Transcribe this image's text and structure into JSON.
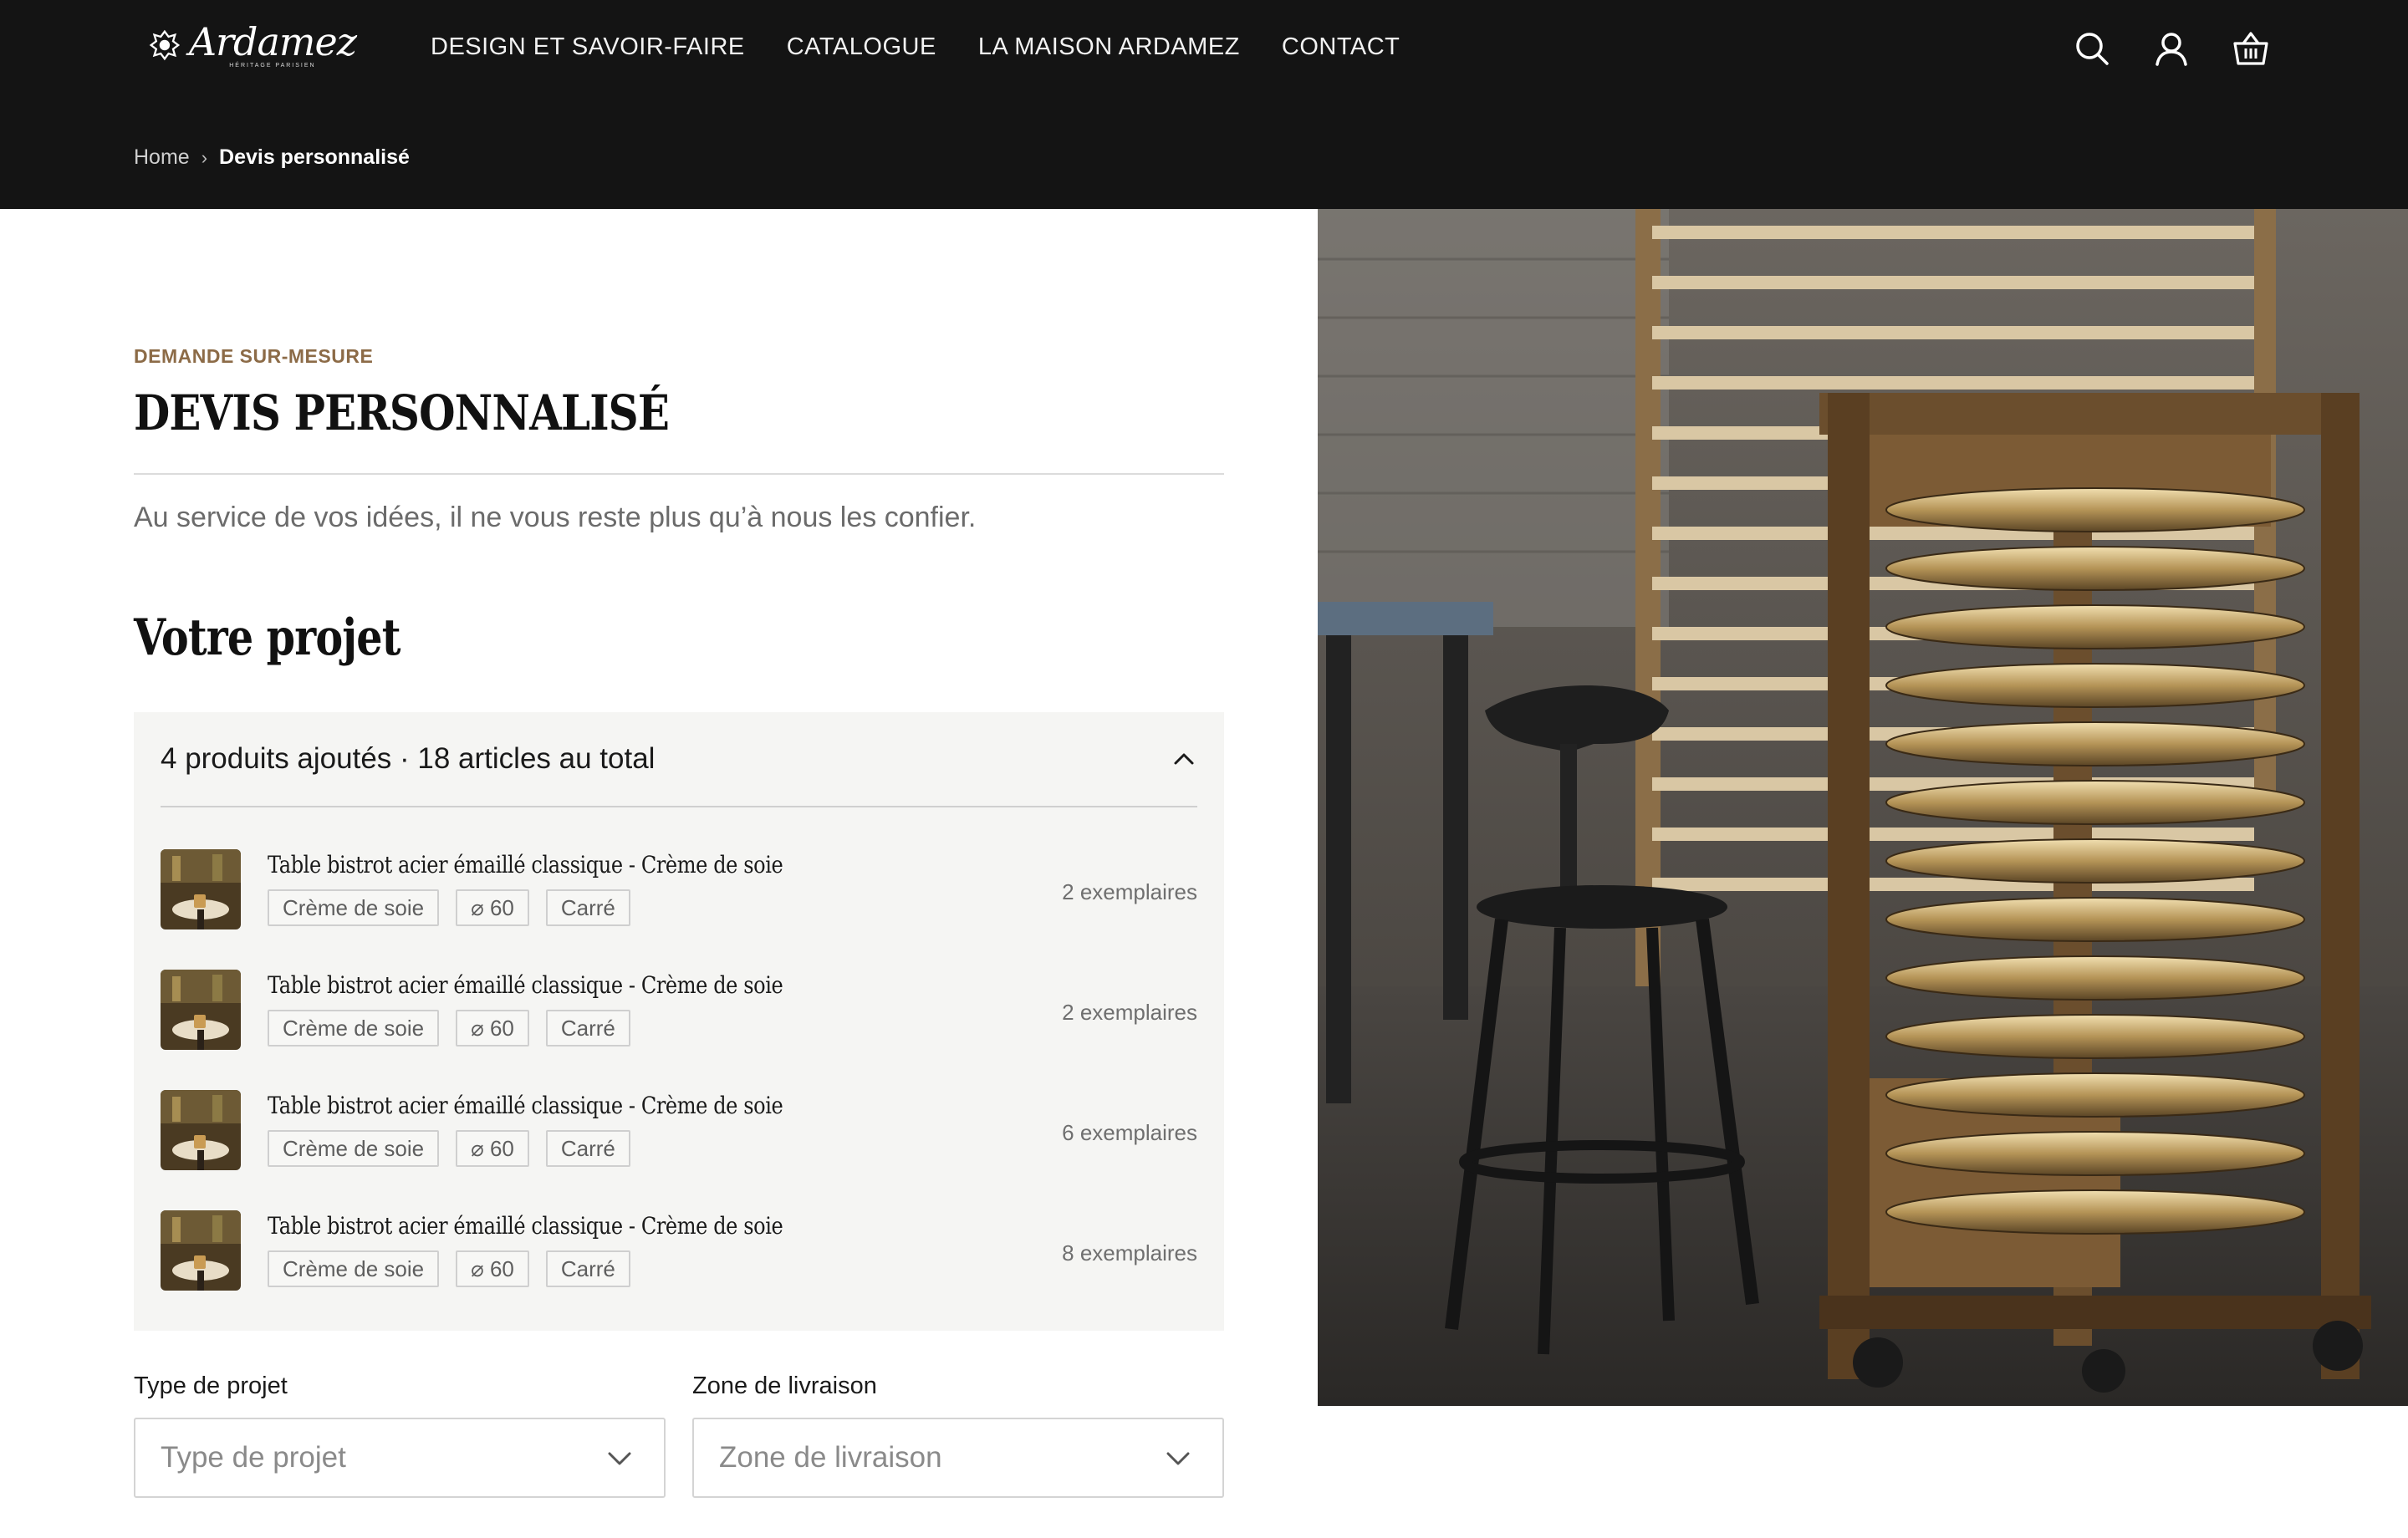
{
  "brand": {
    "name": "Ardamez",
    "tagline": "HÉRITAGE PARISIEN"
  },
  "nav": {
    "items": [
      {
        "label": "DESIGN ET SAVOIR-FAIRE"
      },
      {
        "label": "CATALOGUE"
      },
      {
        "label": "LA MAISON ARDAMEZ"
      },
      {
        "label": "CONTACT"
      }
    ]
  },
  "header_icons": [
    "search-icon",
    "account-icon",
    "basket-icon"
  ],
  "breadcrumb": {
    "home": "Home",
    "separator": "›",
    "current": "Devis personnalisé"
  },
  "page": {
    "eyebrow": "DEMANDE SUR-MESURE",
    "title": "DEVIS PERSONNALISÉ",
    "intro": "Au service de vos idées, il ne vous reste plus qu’à nous les confier.",
    "section_title": "Votre projet"
  },
  "project": {
    "summary": "4 produits ajoutés · 18 articles au total",
    "products": [
      {
        "name": "Table bistrot acier émaillé classique - Crème de soie",
        "tags": [
          "Crème de soie",
          "⌀ 60",
          "Carré"
        ],
        "quantity": "2 exemplaires"
      },
      {
        "name": "Table bistrot acier émaillé classique - Crème de soie",
        "tags": [
          "Crème de soie",
          "⌀ 60",
          "Carré"
        ],
        "quantity": "2 exemplaires"
      },
      {
        "name": "Table bistrot acier émaillé classique - Crème de soie",
        "tags": [
          "Crème de soie",
          "⌀ 60",
          "Carré"
        ],
        "quantity": "6 exemplaires"
      },
      {
        "name": "Table bistrot acier émaillé classique - Crème de soie",
        "tags": [
          "Crème de soie",
          "⌀ 60",
          "Carré"
        ],
        "quantity": "8 exemplaires"
      }
    ]
  },
  "form": {
    "project_type_label": "Type de projet",
    "project_type_placeholder": "Type de projet",
    "delivery_zone_label": "Zone de livraison",
    "delivery_zone_placeholder": "Zone de livraison"
  },
  "colors": {
    "header_bg": "#141414",
    "accent": "#8c6b47",
    "panel_bg": "#f5f5f3"
  }
}
